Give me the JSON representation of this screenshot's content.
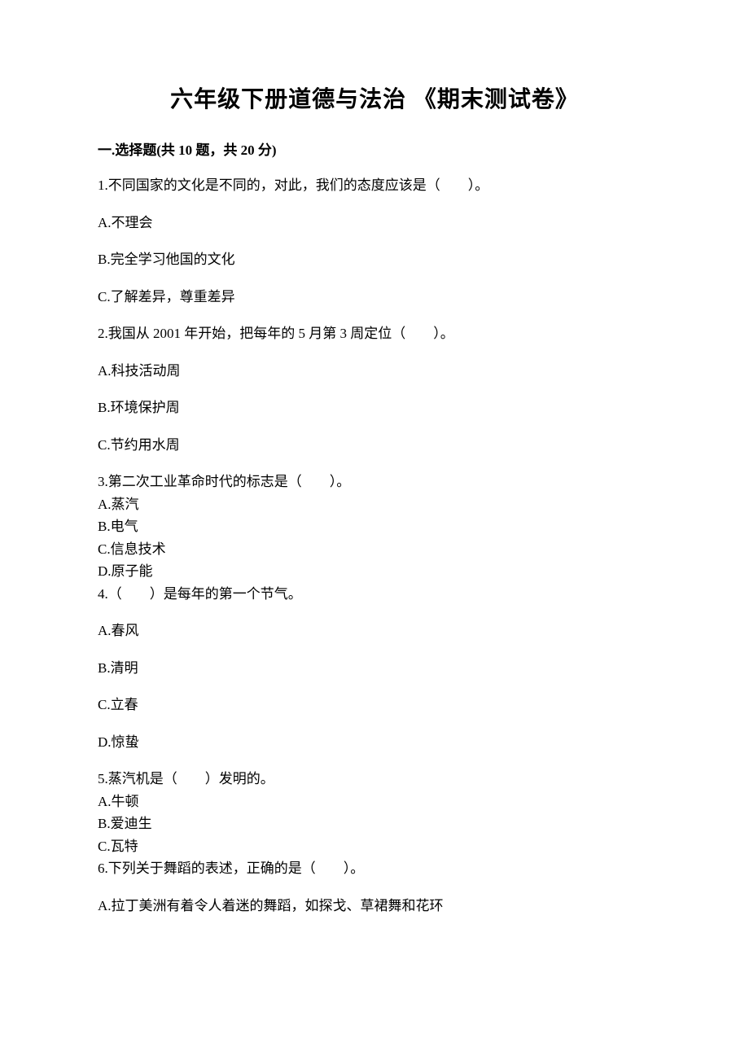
{
  "title": "六年级下册道德与法治 《期末测试卷》",
  "section1": {
    "header": "一.选择题(共 10 题，共 20 分)",
    "q1": {
      "text": "1.不同国家的文化是不同的，对此，我们的态度应该是（　　）。",
      "a": "A.不理会",
      "b": "B.完全学习他国的文化",
      "c": "C.了解差异，尊重差异"
    },
    "q2": {
      "text": "2.我国从 2001 年开始，把每年的 5 月第 3 周定位（　　）。",
      "a": "A.科技活动周",
      "b": "B.环境保护周",
      "c": "C.节约用水周"
    },
    "q3": {
      "text": "3.第二次工业革命时代的标志是（　　）。",
      "a": "A.蒸汽",
      "b": "B.电气",
      "c": "C.信息技术",
      "d": "D.原子能"
    },
    "q4": {
      "text": "4.（　　）是每年的第一个节气。",
      "a": "A.春风",
      "b": "B.清明",
      "c": "C.立春",
      "d": "D.惊蛰"
    },
    "q5": {
      "text": "5.蒸汽机是（　　）发明的。",
      "a": "A.牛顿",
      "b": "B.爱迪生",
      "c": "C.瓦特"
    },
    "q6": {
      "text": "6.下列关于舞蹈的表述，正确的是（　　）。",
      "a": "A.拉丁美洲有着令人着迷的舞蹈，如探戈、草裙舞和花环"
    }
  }
}
